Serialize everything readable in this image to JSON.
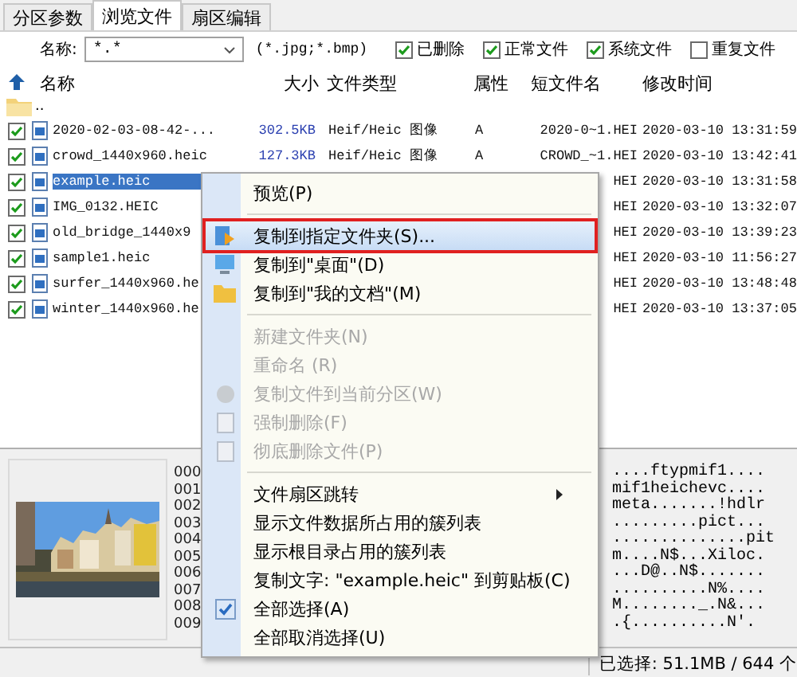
{
  "tabs": [
    {
      "label": "分区参数",
      "selected": false
    },
    {
      "label": "浏览文件",
      "selected": true
    },
    {
      "label": "扇区编辑",
      "selected": false
    }
  ],
  "filter": {
    "label": "名称:",
    "value": "*.*",
    "hint": "(*.jpg;*.bmp)",
    "options": [
      {
        "label": "已删除",
        "checked": true
      },
      {
        "label": "正常文件",
        "checked": true
      },
      {
        "label": "系统文件",
        "checked": true
      },
      {
        "label": "重复文件",
        "checked": false
      }
    ]
  },
  "columns": [
    "名称",
    "大小",
    "文件类型",
    "属性",
    "短文件名",
    "修改时间"
  ],
  "parent": "..",
  "rows": [
    {
      "name": "2020-02-03-08-42-...",
      "size": "302.5KB",
      "type": "Heif/Heic 图像",
      "attr": "A",
      "short_name": "2020-0~1.HEI",
      "time": "2020-03-10 13:31:59",
      "checked": true,
      "selected": false
    },
    {
      "name": "crowd_1440x960.heic",
      "size": "127.3KB",
      "type": "Heif/Heic 图像",
      "attr": "A",
      "short_name": "CROWD_~1.HEI",
      "time": "2020-03-10 13:42:41",
      "checked": true,
      "selected": false
    },
    {
      "name": "example.heic",
      "short_name": "HEI",
      "time": "2020-03-10 13:31:58",
      "checked": true,
      "selected": true
    },
    {
      "name": "IMG_0132.HEIC",
      "short_name": "HEI",
      "time": "2020-03-10 13:32:07",
      "checked": true,
      "selected": false
    },
    {
      "name": "old_bridge_1440x9",
      "short_name": "HEI",
      "time": "2020-03-10 13:39:23",
      "checked": true,
      "selected": false
    },
    {
      "name": "sample1.heic",
      "short_name": "HEI",
      "time": "2020-03-10 11:56:27",
      "checked": true,
      "selected": false
    },
    {
      "name": "surfer_1440x960.he",
      "short_name": "HEI",
      "time": "2020-03-10 13:48:48",
      "checked": true,
      "selected": false
    },
    {
      "name": "winter_1440x960.he",
      "short_name": "HEI",
      "time": "2020-03-10 13:37:05",
      "checked": true,
      "selected": false
    }
  ],
  "hex_offsets": [
    "000",
    "001",
    "002",
    "003",
    "004",
    "005",
    "006",
    "007",
    "008",
    "009"
  ],
  "ascii_lines": [
    "....ftypmif1....",
    "mif1heichevc....",
    "meta.......!hdlr",
    ".........pict...",
    "..............pit",
    "m....N$...Xiloc.",
    "...D@..N$.......",
    "..........N%....",
    "M........_.N&...",
    ".{..........N'."
  ],
  "context_menu": [
    {
      "kind": "item",
      "label": "预览(P)",
      "disabled": false,
      "selected": false
    },
    {
      "kind": "separator"
    },
    {
      "kind": "item",
      "label": "复制到指定文件夹(S)...",
      "disabled": false,
      "selected": true
    },
    {
      "kind": "item",
      "label": "复制到\"桌面\"(D)",
      "disabled": false,
      "selected": false
    },
    {
      "kind": "item",
      "label": "复制到\"我的文档\"(M)",
      "disabled": false,
      "selected": false
    },
    {
      "kind": "separator"
    },
    {
      "kind": "item",
      "label": "新建文件夹(N)",
      "disabled": true,
      "selected": false
    },
    {
      "kind": "item",
      "label": "重命名 (R)",
      "disabled": true,
      "selected": false
    },
    {
      "kind": "item",
      "label": "复制文件到当前分区(W)",
      "disabled": true,
      "selected": false
    },
    {
      "kind": "item",
      "label": "强制删除(F)",
      "disabled": true,
      "selected": false
    },
    {
      "kind": "item",
      "label": "彻底删除文件(P)",
      "disabled": true,
      "selected": false
    },
    {
      "kind": "separator"
    },
    {
      "kind": "submenu",
      "label": "文件扇区跳转",
      "disabled": false,
      "selected": false
    },
    {
      "kind": "item",
      "label": "显示文件数据所占用的簇列表",
      "disabled": false,
      "selected": false
    },
    {
      "kind": "item",
      "label": "显示根目录占用的簇列表",
      "disabled": false,
      "selected": false
    },
    {
      "kind": "item",
      "label": "复制文字: \"example.heic\" 到剪贴板(C)",
      "disabled": false,
      "selected": false
    },
    {
      "kind": "item",
      "label": "全部选择(A)",
      "disabled": false,
      "selected": false
    },
    {
      "kind": "item",
      "label": "全部取消选择(U)",
      "disabled": false,
      "selected": false
    }
  ],
  "status_bar": "已选择: 51.1MB / 644 个"
}
